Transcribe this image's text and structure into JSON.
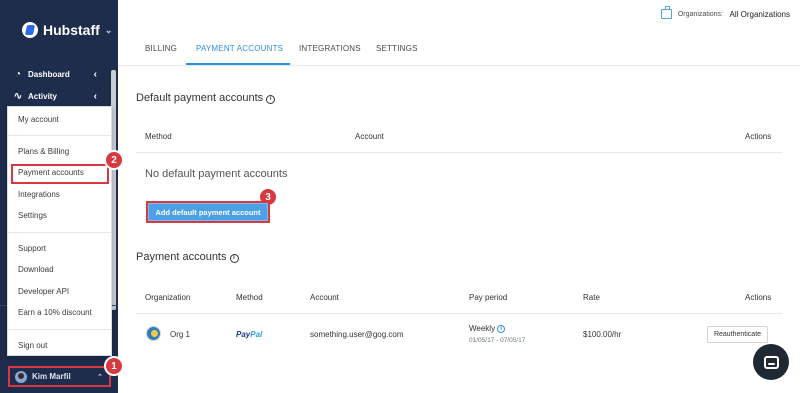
{
  "brand": {
    "name": "Hubstaff",
    "caret": "⌄"
  },
  "sidebar": {
    "items": [
      {
        "label": "Dashboard",
        "icon": "dashboard-icon",
        "chevron": "‹"
      },
      {
        "label": "Activity",
        "icon": "activity-icon",
        "chevron": "‹"
      }
    ],
    "user": {
      "name": "Kim Marfil",
      "caret": "⌃"
    }
  },
  "menu": {
    "items": [
      "My account",
      "Plans & Billing",
      "Payment accounts",
      "Integrations",
      "Settings",
      "Support",
      "Download",
      "Developer API",
      "Earn a 10% discount",
      "Sign out"
    ],
    "highlighted": "Payment accounts"
  },
  "badges": [
    "1",
    "2",
    "3"
  ],
  "topbar": {
    "org_label": "Organizations:",
    "org_value": "All Organizations"
  },
  "tabs": [
    {
      "label": "BILLING",
      "active": false
    },
    {
      "label": "PAYMENT ACCOUNTS",
      "active": true
    },
    {
      "label": "INTEGRATIONS",
      "active": false
    },
    {
      "label": "SETTINGS",
      "active": false
    }
  ],
  "default_section": {
    "title": "Default payment accounts",
    "info": "i",
    "headers": {
      "method": "Method",
      "account": "Account",
      "actions": "Actions"
    },
    "empty_text": "No default payment accounts",
    "add_button": "Add default payment account"
  },
  "accounts_section": {
    "title": "Payment accounts",
    "info": "i",
    "headers": {
      "organization": "Organization",
      "method": "Method",
      "account": "Account",
      "pay_period": "Pay period",
      "rate": "Rate",
      "actions": "Actions"
    },
    "rows": [
      {
        "organization": "Org 1",
        "method_part1": "Pay",
        "method_part2": "Pal",
        "account": "something.user@gog.com",
        "pay_period": "Weekly",
        "pay_period_info": "i",
        "pay_dates": "01/05/17 - 07/05/17",
        "rate": "$100.00/hr",
        "action": "Reauthenticate"
      }
    ]
  },
  "colors": {
    "sidebar": "#1f2d4d",
    "accent": "#2f8fd8",
    "highlight": "#d8383f",
    "button": "#4ca1e6"
  }
}
